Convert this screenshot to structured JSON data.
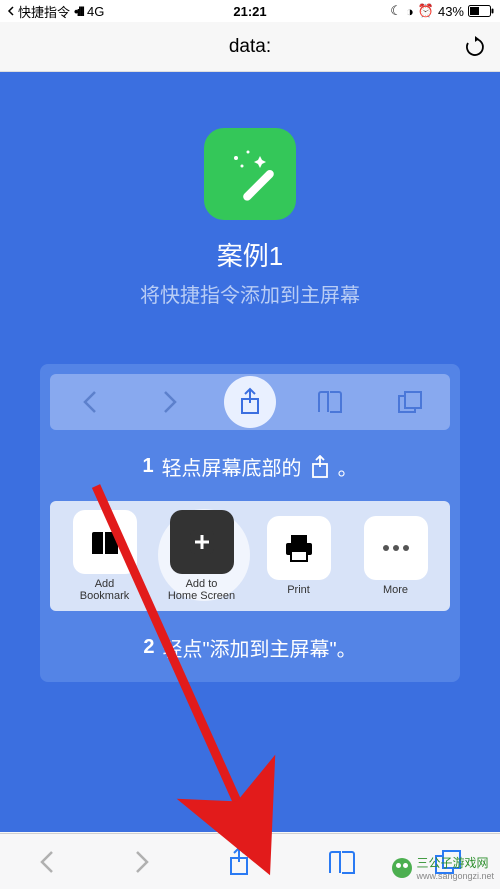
{
  "status": {
    "back_app": "快捷指令",
    "network": "4G",
    "time": "21:21",
    "battery_pct": "43%",
    "moon_icon": "☾",
    "dnd_icon": "◑",
    "alarm_icon": "⏰"
  },
  "url_bar": {
    "url_text": "data:"
  },
  "hero": {
    "title": "案例1",
    "subtitle": "将快捷指令添加到主屏幕"
  },
  "step1": {
    "num": "1",
    "text_before": "轻点屏幕底部的",
    "text_after": "。"
  },
  "share_sheet": {
    "items": [
      {
        "label": "Add\nBookmark"
      },
      {
        "label": "Add to\nHome Screen"
      },
      {
        "label": "Print"
      },
      {
        "label": "More"
      }
    ]
  },
  "step2": {
    "num": "2",
    "text": "轻点\"添加到主屏幕\"。"
  },
  "watermark": {
    "text": "三公子游戏网",
    "url": "www.sangongzi.net"
  }
}
